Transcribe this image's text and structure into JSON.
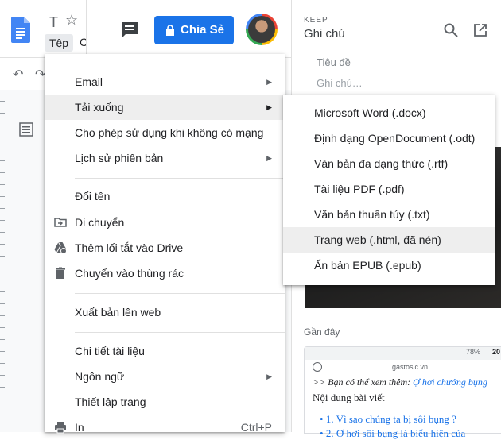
{
  "header": {
    "doc_title": "T",
    "menu_file": "Tệp",
    "menu_next": "C",
    "share_label": "Chia Sẻ"
  },
  "keep": {
    "label": "KEEP",
    "title": "Ghi chú",
    "note_title_placeholder": "Tiêu đề",
    "note_body_placeholder": "Ghi chú…",
    "recent_label": "Gần đây",
    "recent_card": {
      "battery": "78%",
      "time": "20",
      "url": "gastosic.vn",
      "line1_prefix": ">> Bạn có thể xem thêm: ",
      "line1_link": "Ợ hơi chướng bụng",
      "line2": "Nội dung bài viết",
      "bullet1": "1. Vì sao chúng ta bị sôi bụng ?",
      "bullet2": "2. Ợ hơi sôi bụng là biểu hiện của"
    }
  },
  "file_menu": {
    "items": [
      {
        "label": "Email",
        "has_submenu": true
      },
      {
        "label": "Tải xuống",
        "has_submenu": true
      },
      {
        "label": "Cho phép sử dụng khi không có mạng"
      },
      {
        "label": "Lịch sử phiên bản",
        "has_submenu": true
      },
      {
        "label": "Đổi tên"
      },
      {
        "label": "Di chuyển",
        "icon": "move-folder-icon"
      },
      {
        "label": "Thêm lối tắt vào Drive",
        "icon": "drive-shortcut-icon"
      },
      {
        "label": "Chuyển vào thùng rác",
        "icon": "trash-icon"
      },
      {
        "label": "Xuất bản lên web"
      },
      {
        "label": "Chi tiết tài liệu"
      },
      {
        "label": "Ngôn ngữ",
        "has_submenu": true
      },
      {
        "label": "Thiết lập trang"
      },
      {
        "label": "In",
        "icon": "print-icon",
        "shortcut": "Ctrl+P"
      }
    ]
  },
  "download_submenu": {
    "items": [
      "Microsoft Word (.docx)",
      "Định dạng OpenDocument (.odt)",
      "Văn bản đa dạng thức (.rtf)",
      "Tài liệu PDF (.pdf)",
      "Văn bản thuần túy (.txt)",
      "Trang web (.html, đã nén)",
      "Ấn bản EPUB (.epub)"
    ],
    "highlighted": "Trang web (.html, đã nén)"
  },
  "colors": {
    "accent": "#1a73e8",
    "hover": "#eeeeee"
  }
}
